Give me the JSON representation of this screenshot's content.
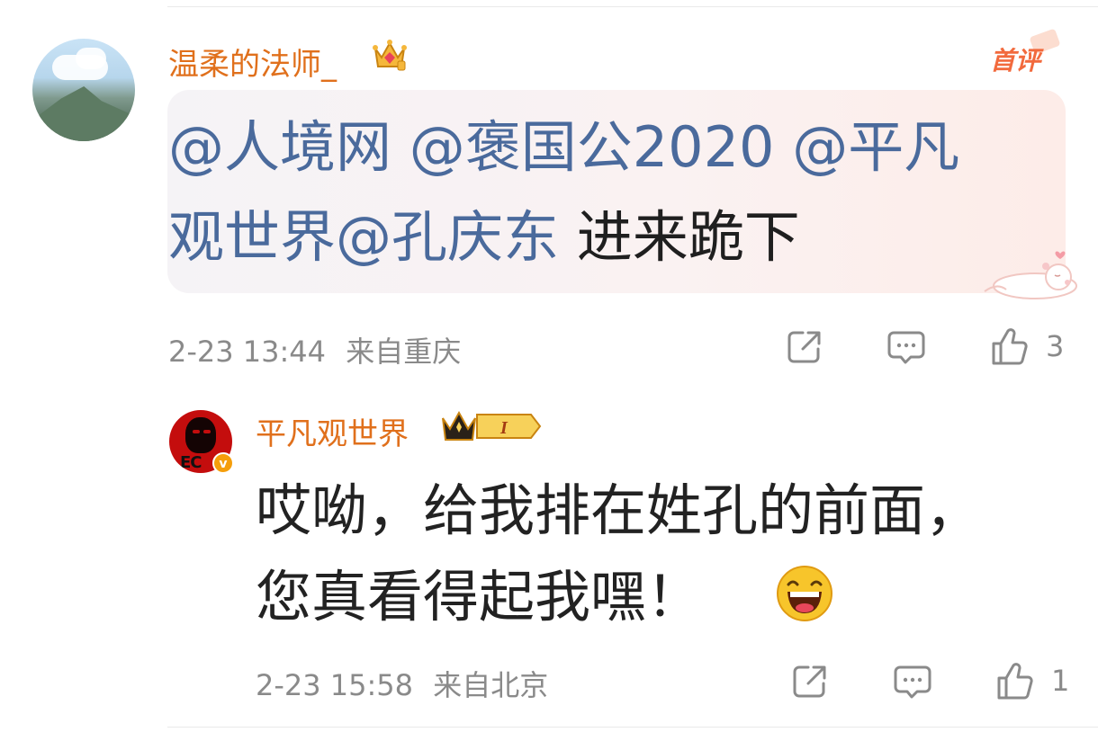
{
  "comment": {
    "username": "温柔的法师_",
    "first_tag": "首评",
    "mentions_line1": "@人境网 @褒国公2020 @平凡",
    "mentions_line2": "观世界@孔庆东",
    "text_tail": " 进来跪下",
    "date": "2-23 13:44",
    "location": "来自重庆",
    "like_count": "3"
  },
  "reply": {
    "username": "平凡观世界",
    "level_badge": "I",
    "verified_mark": "v",
    "line1": "哎呦，给我排在姓孔的前面，",
    "line2": "您真看得起我嘿！",
    "emoji": "laughing-emoji",
    "date": "2-23 15:58",
    "location": "来自北京",
    "like_count": "1"
  },
  "icons": {
    "share": "share-icon",
    "comment": "comment-icon",
    "like": "like-icon"
  },
  "colors": {
    "username": "#e0701c",
    "mention": "#4a6a9c",
    "meta": "#8a8a8a",
    "first_tag": "#f26a3d"
  }
}
